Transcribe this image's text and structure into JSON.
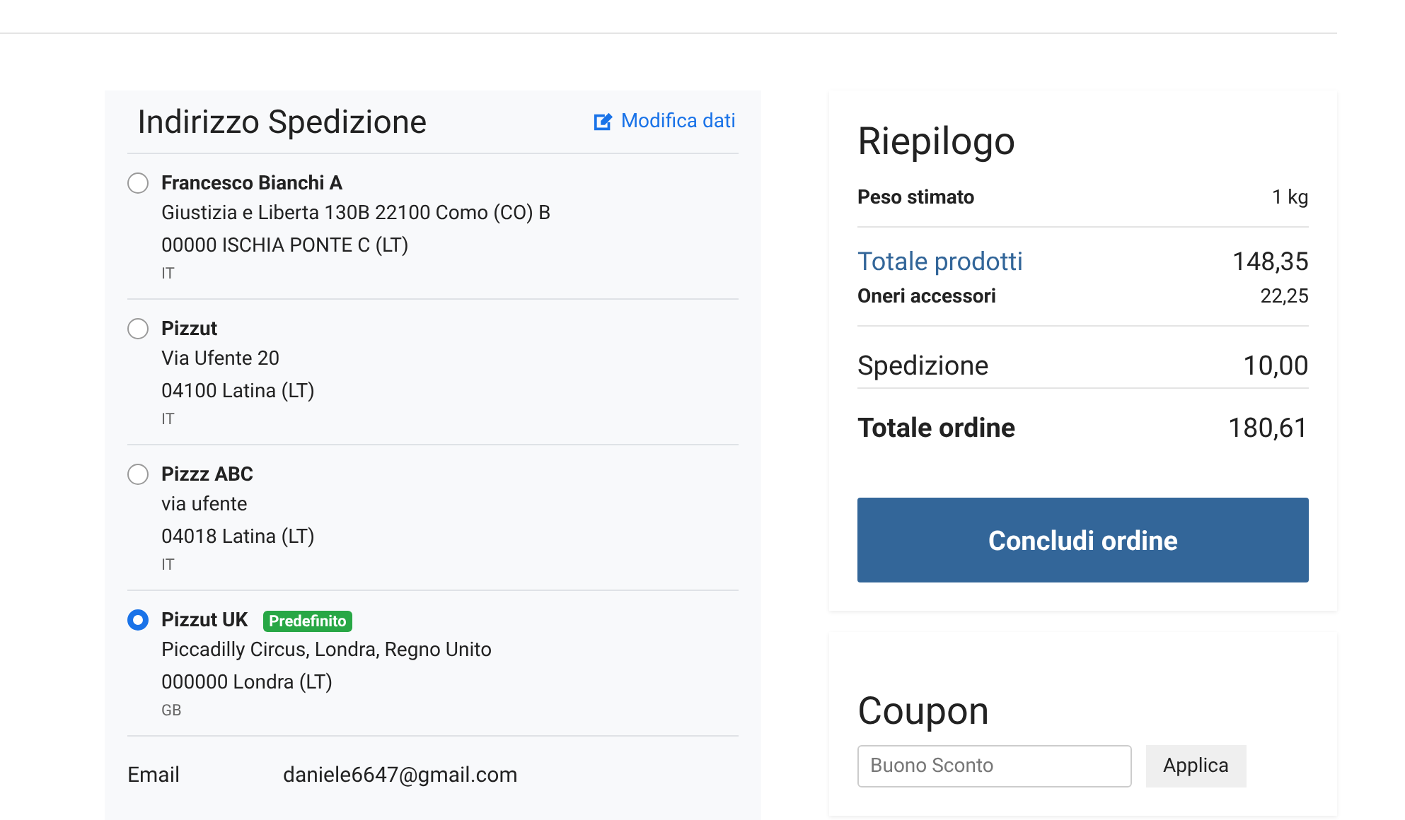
{
  "shipping": {
    "title": "Indirizzo Spedizione",
    "edit_link": "Modifica dati",
    "addresses": [
      {
        "name": "Francesco Bianchi A",
        "lines": [
          "Giustizia e Liberta 130B 22100 Como (CO) B",
          "00000 ISCHIA PONTE C (LT)"
        ],
        "country": "IT",
        "selected": false
      },
      {
        "name": "Pizzut",
        "lines": [
          "Via Ufente 20",
          "04100 Latina (LT)"
        ],
        "country": "IT",
        "selected": false
      },
      {
        "name": "Pizzz ABC",
        "lines": [
          "via ufente",
          "04018 Latina (LT)"
        ],
        "country": "IT",
        "selected": false
      },
      {
        "name": "Pizzut UK",
        "badge": "Predefinito",
        "lines": [
          "Piccadilly Circus, Londra, Regno Unito",
          "000000 Londra (LT)"
        ],
        "country": "GB",
        "selected": true
      }
    ],
    "email": {
      "label": "Email",
      "value": "daniele6647@gmail.com"
    }
  },
  "summary": {
    "title": "Riepilogo",
    "rows": [
      {
        "kind": "minor",
        "label": "Peso stimato",
        "value": "1 kg"
      },
      {
        "kind": "accent",
        "label": "Totale prodotti",
        "value": "148,35"
      },
      {
        "kind": "minor",
        "label": "Oneri accessori",
        "value": "22,25"
      },
      {
        "kind": "large",
        "label": "Spedizione",
        "value": "10,00"
      },
      {
        "kind": "total",
        "label": "Totale ordine",
        "value": "180,61"
      }
    ],
    "button": "Concludi ordine"
  },
  "coupon": {
    "title": "Coupon",
    "placeholder": "Buono Sconto",
    "button": "Applica"
  }
}
